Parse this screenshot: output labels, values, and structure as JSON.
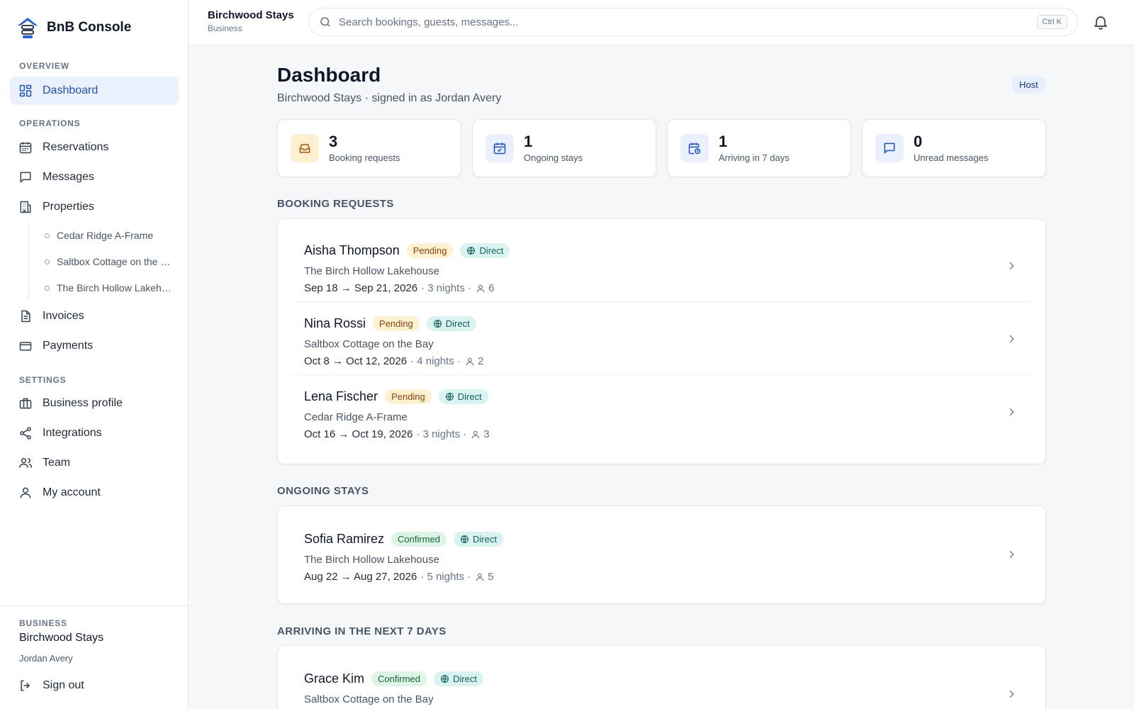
{
  "brand": {
    "name": "BnB Console"
  },
  "sidebar": {
    "sections": {
      "overview": "OVERVIEW",
      "operations": "OPERATIONS",
      "settings": "SETTINGS"
    },
    "items": {
      "dashboard": "Dashboard",
      "reservations": "Reservations",
      "messages": "Messages",
      "properties": "Properties",
      "invoices": "Invoices",
      "payments": "Payments",
      "business_profile": "Business profile",
      "integrations": "Integrations",
      "team": "Team",
      "my_account": "My account"
    },
    "properties": [
      "Cedar Ridge A-Frame",
      "Saltbox Cottage on the Bay",
      "The Birch Hollow Lakehouse"
    ],
    "footer": {
      "label": "BUSINESS",
      "business_name": "Birchwood Stays",
      "user_name": "Jordan Avery",
      "sign_out": "Sign out"
    }
  },
  "topbar": {
    "title": "Birchwood Stays",
    "subtitle": "Business",
    "search_placeholder": "Search bookings, guests, messages...",
    "shortcut": "Ctrl K"
  },
  "page": {
    "title": "Dashboard",
    "subtitle": "Birchwood Stays · signed in as Jordan Avery",
    "role_badge": "Host"
  },
  "stats": [
    {
      "value": "3",
      "label": "Booking requests",
      "icon": "inbox-icon",
      "bg": "#fdf0d0",
      "color": "#b45309"
    },
    {
      "value": "1",
      "label": "Ongoing stays",
      "icon": "calendar-check-icon",
      "bg": "#eaf1fd",
      "color": "#1d4ed8"
    },
    {
      "value": "1",
      "label": "Arriving in 7 days",
      "icon": "calendar-clock-icon",
      "bg": "#eaf1fd",
      "color": "#1d4ed8"
    },
    {
      "value": "0",
      "label": "Unread messages",
      "icon": "message-icon",
      "bg": "#eaf1fd",
      "color": "#1d4ed8"
    }
  ],
  "sections": {
    "booking_requests": {
      "title": "BOOKING REQUESTS",
      "rows": [
        {
          "guest": "Aisha Thompson",
          "status": "Pending",
          "channel": "Direct",
          "property": "The Birch Hollow Lakehouse",
          "dates": "Sep 18 → Sep 21, 2026",
          "nights": "· 3 nights ·",
          "guests": "6"
        },
        {
          "guest": "Nina Rossi",
          "status": "Pending",
          "channel": "Direct",
          "property": "Saltbox Cottage on the Bay",
          "dates": "Oct 8 → Oct 12, 2026",
          "nights": "· 4 nights ·",
          "guests": "2"
        },
        {
          "guest": "Lena Fischer",
          "status": "Pending",
          "channel": "Direct",
          "property": "Cedar Ridge A-Frame",
          "dates": "Oct 16 → Oct 19, 2026",
          "nights": "· 3 nights ·",
          "guests": "3"
        }
      ]
    },
    "ongoing_stays": {
      "title": "ONGOING STAYS",
      "rows": [
        {
          "guest": "Sofia Ramirez",
          "status": "Confirmed",
          "channel": "Direct",
          "property": "The Birch Hollow Lakehouse",
          "dates": "Aug 22 → Aug 27, 2026",
          "nights": "· 5 nights ·",
          "guests": "5"
        }
      ]
    },
    "arriving": {
      "title": "ARRIVING IN THE NEXT 7 DAYS",
      "rows": [
        {
          "guest": "Grace Kim",
          "status": "Confirmed",
          "channel": "Direct",
          "property": "Saltbox Cottage on the Bay"
        }
      ]
    }
  },
  "colors": {
    "accent": "#1d4ed8",
    "pending_bg": "#fdf1cf",
    "confirmed_bg": "#dcf5e6",
    "direct_bg": "#d9f3f1"
  }
}
